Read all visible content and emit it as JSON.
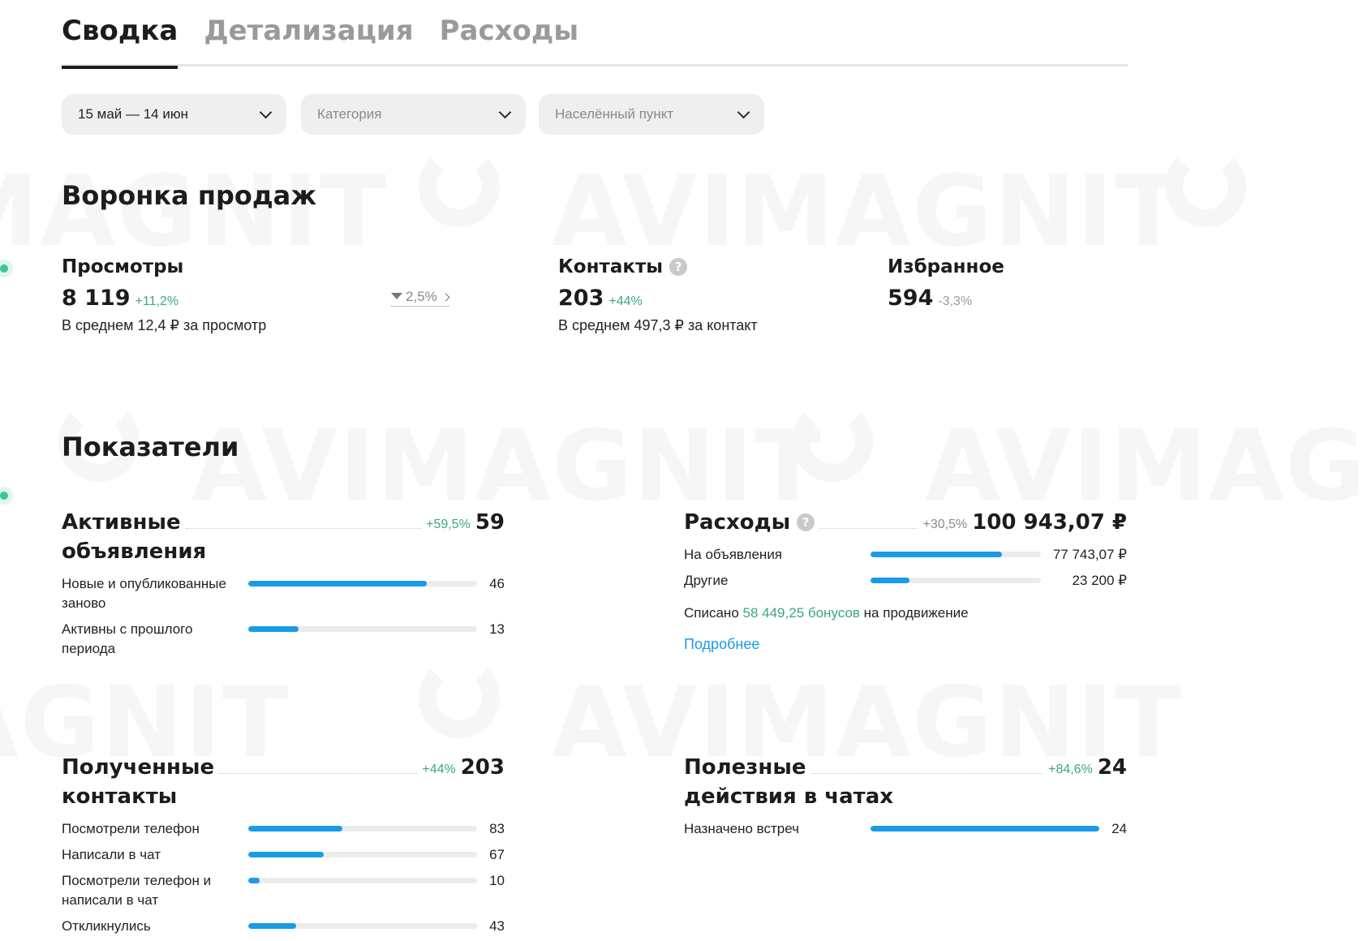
{
  "watermark": "AVIMAGNIT",
  "tabs": [
    {
      "label": "Сводка",
      "active": true
    },
    {
      "label": "Детализация",
      "active": false
    },
    {
      "label": "Расходы",
      "active": false
    }
  ],
  "filters": {
    "period": "15 май — 14 июн",
    "category_placeholder": "Категория",
    "city_placeholder": "Населённый пункт"
  },
  "funnel": {
    "title": "Воронка продаж",
    "views": {
      "label": "Просмотры",
      "value": "8 119",
      "delta": "+11,2%",
      "sub": "В среднем 12,4 ₽ за просмотр"
    },
    "conversion": "2,5%",
    "contacts": {
      "label": "Контакты",
      "value": "203",
      "delta": "+44%",
      "sub": "В среднем 497,3 ₽ за контакт"
    },
    "favorites": {
      "label": "Избранное",
      "value": "594",
      "delta": "-3,3%"
    }
  },
  "indicators": {
    "title": "Показатели",
    "active_ads": {
      "title_line1": "Активные",
      "title_line2": "объявления",
      "delta": "+59,5%",
      "value": "59",
      "rows": [
        {
          "label": "Новые и опубликованные заново",
          "value": "46",
          "fraction": 0.78
        },
        {
          "label": "Активны с прошлого периода",
          "value": "13",
          "fraction": 0.22
        }
      ]
    },
    "expenses": {
      "title": "Расходы",
      "delta": "+30,5%",
      "value": "100 943,07 ₽",
      "rows": [
        {
          "label": "На объявления",
          "value": "77 743,07 ₽",
          "fraction": 0.77
        },
        {
          "label": "Другие",
          "value": "23 200 ₽",
          "fraction": 0.23
        }
      ],
      "written_off_prefix": "Списано",
      "written_off_link": "58 449,25 бонусов",
      "written_off_suffix": "на продвижение",
      "more": "Подробнее"
    },
    "received_contacts": {
      "title_line1": "Полученные",
      "title_line2": "контакты",
      "delta": "+44%",
      "value": "203",
      "rows": [
        {
          "label": "Посмотрели телефон",
          "value": "83",
          "fraction": 0.41
        },
        {
          "label": "Написали в чат",
          "value": "67",
          "fraction": 0.33
        },
        {
          "label": "Посмотрели телефон и написали в чат",
          "value": "10",
          "fraction": 0.05
        },
        {
          "label": "Откликнулись",
          "value": "43",
          "fraction": 0.21
        }
      ]
    },
    "chat_actions": {
      "title_line1": "Полезные",
      "title_line2": "действия в чатах",
      "delta": "+84,6%",
      "value": "24",
      "rows": [
        {
          "label": "Назначено встреч",
          "value": "24",
          "fraction": 1.0
        }
      ]
    }
  }
}
